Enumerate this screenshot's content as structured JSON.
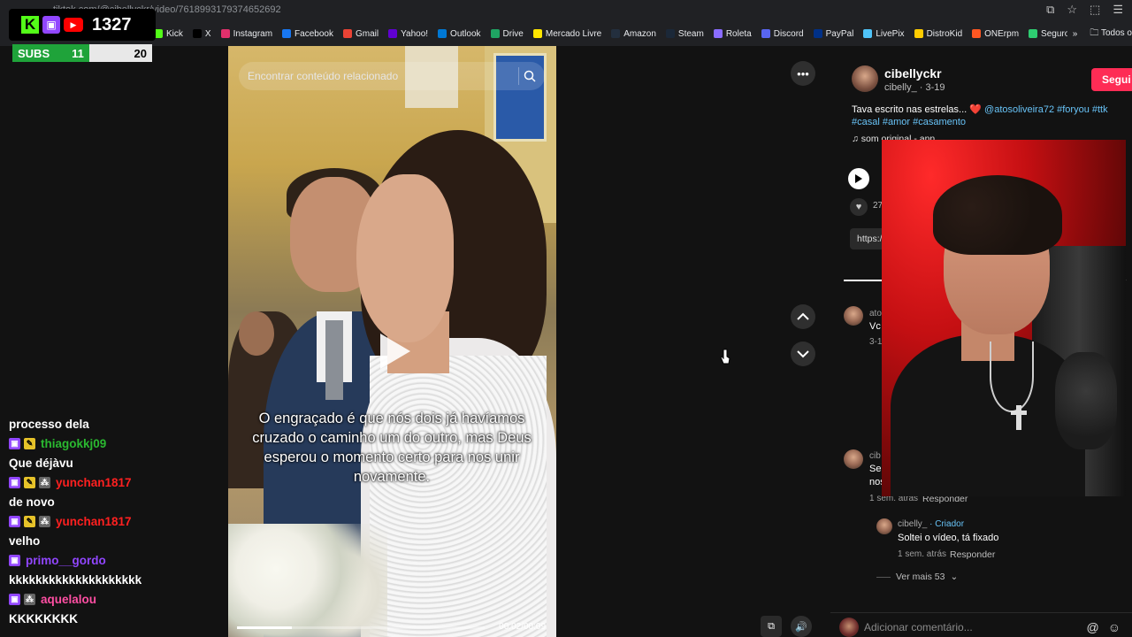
{
  "browser": {
    "url": "tiktok.com/@cibellyckr/video/7618993179374652692",
    "bookmarks": [
      {
        "label": "Kick",
        "color": "#53fc18"
      },
      {
        "label": "X",
        "color": "#000000"
      },
      {
        "label": "Instagram",
        "color": "#e1306c"
      },
      {
        "label": "Facebook",
        "color": "#1877f2"
      },
      {
        "label": "Gmail",
        "color": "#ea4335"
      },
      {
        "label": "Yahoo!",
        "color": "#6001d2"
      },
      {
        "label": "Outlook",
        "color": "#0078d4"
      },
      {
        "label": "Drive",
        "color": "#1fa463"
      },
      {
        "label": "Mercado Livre",
        "color": "#ffe600"
      },
      {
        "label": "Amazon",
        "color": "#232f3e"
      },
      {
        "label": "Steam",
        "color": "#1b2838"
      },
      {
        "label": "Roleta",
        "color": "#8a6cff"
      },
      {
        "label": "Discord",
        "color": "#5865f2"
      },
      {
        "label": "PayPal",
        "color": "#003087"
      },
      {
        "label": "LivePix",
        "color": "#4fc3f7"
      },
      {
        "label": "DistroKid",
        "color": "#ffcc00"
      },
      {
        "label": "ONErpm",
        "color": "#ff5722"
      },
      {
        "label": "Seguro",
        "color": "#2ecc71"
      }
    ],
    "all_bookmarks": "Todos o"
  },
  "overlay": {
    "counter": "1327",
    "subs_label": "SUBS",
    "subs_current": "11",
    "subs_goal": "20",
    "subs_progress": 0.55
  },
  "chat": [
    {
      "user": "",
      "message": "processo dela",
      "color": "#ffffff",
      "badges": []
    },
    {
      "user": "thiagokkj09",
      "message": "Que déjàvu",
      "color": "#2ab930",
      "badges": [
        "twitch",
        "gold"
      ]
    },
    {
      "user": "yunchan1817",
      "message": "de novo",
      "color": "#ff2020",
      "badges": [
        "twitch",
        "gold",
        "gray"
      ]
    },
    {
      "user": "yunchan1817",
      "message": "velho",
      "color": "#ff2020",
      "badges": [
        "twitch",
        "gold",
        "gray"
      ]
    },
    {
      "user": "primo__gordo",
      "message": "kkkkkkkkkkkkkkkkkkkk",
      "color": "#9146ff",
      "badges": [
        "twitch"
      ]
    },
    {
      "user": "aquelalou",
      "message": "KKKKKKKK",
      "color": "#ff4fa3",
      "badges": [
        "twitch",
        "gray"
      ]
    }
  ],
  "video": {
    "search_placeholder": "Encontrar conteúdo relacionado",
    "caption": "O engraçado é que nós dois já havíamos cruzado o caminho um do outro, mas Deus esperou o momento certo para nos unir novamente.",
    "time": "00:02/00:09",
    "progress": 0.22
  },
  "post": {
    "author": "cibellyckr",
    "author_sub": "cibelly_ · 3-19",
    "follow": "Segui",
    "description": "Tava escrito nas estrelas... ❤️ ",
    "hashtags": "@atosoliveira72 #foryou #ttk #casal #amor #casamento",
    "music": "♫ som original - ann",
    "likes": "27",
    "link": "https://"
  },
  "comments": [
    {
      "user": "ato",
      "text": "Vc",
      "time": "3-1"
    },
    {
      "user": "cib",
      "text": "Se",
      "text2": "nos",
      "time": "1 sem. atrás",
      "reply": "Responder"
    }
  ],
  "reply": {
    "user": "cibelly_",
    "creator": "· Criador",
    "text": "Soltei o vídeo, tá fixado",
    "time": "1 sem. atrás",
    "reply": "Responder"
  },
  "more_replies": "Ver mais 53",
  "add_comment_placeholder": "Adicionar comentário..."
}
